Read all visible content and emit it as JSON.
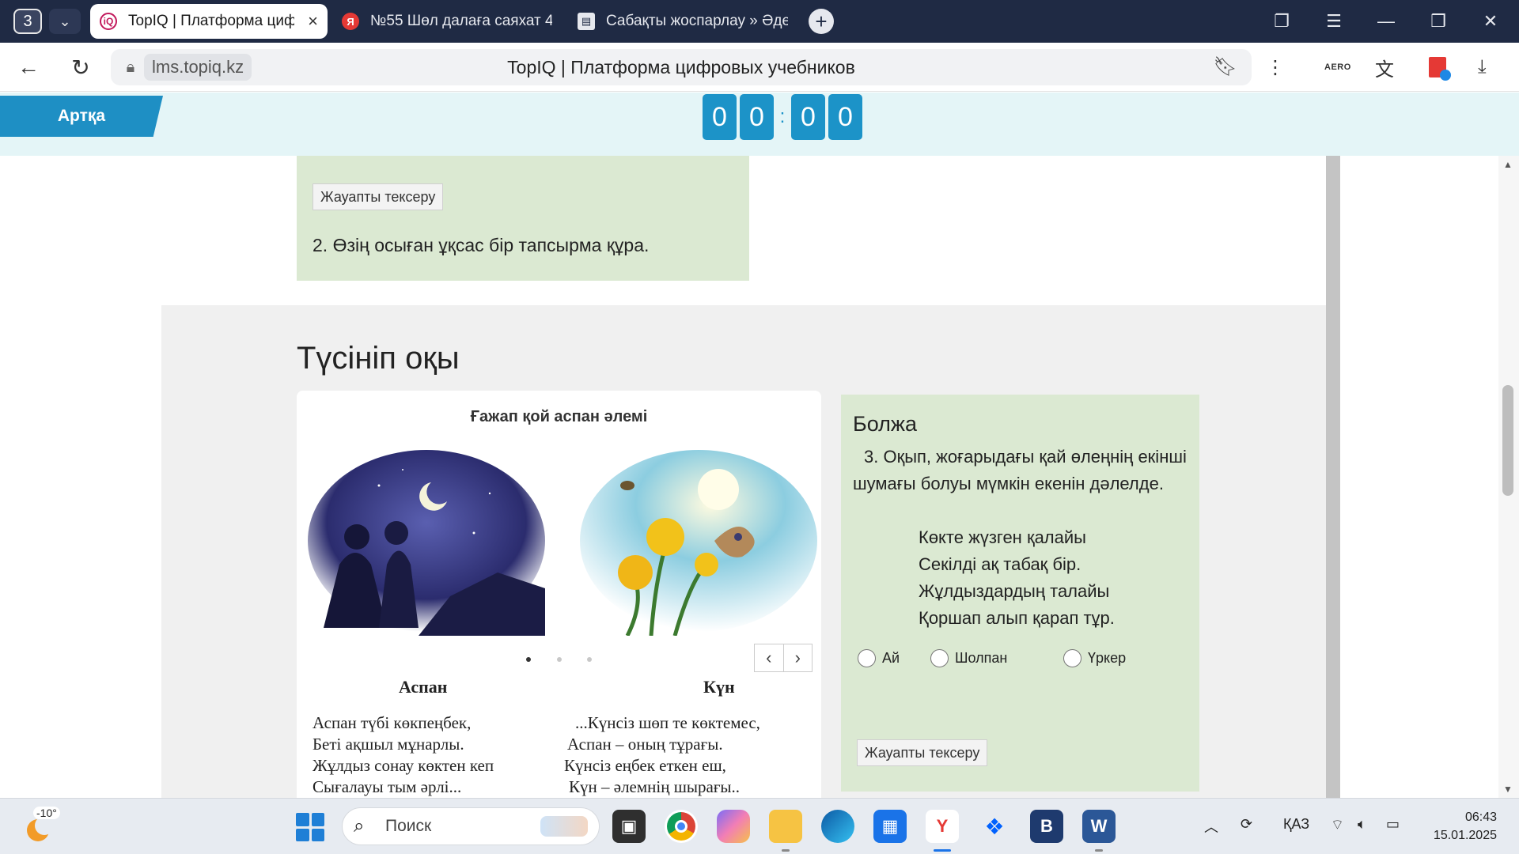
{
  "browser": {
    "tab_count": "3",
    "tabs": [
      {
        "title": "TopIQ | Платформа цифровых учебников",
        "visible": "TopIQ | Платформа циф"
      },
      {
        "title": "№55 Шөл далаға саяхат 4",
        "visible": "№55 Шөл далаға саяхат 4"
      },
      {
        "title": "Сабақты жоспарлау » Әде",
        "visible": "Сабақты жоспарлау » Әде"
      }
    ],
    "domain": "lms.topiq.kz",
    "page_title": "TopIQ | Платформа цифровых учебников",
    "aero_label": "AERO"
  },
  "app": {
    "back_label": "Артқа",
    "timer": [
      "0",
      "0",
      "0",
      "0"
    ],
    "timer_sep": ":"
  },
  "content": {
    "check_answer_1": "Жауапты тексеру",
    "task2": "2. Өзің осыған ұқсас бір тапсырма құра.",
    "section_title": "Түсініп оқы",
    "story": {
      "title": "Ғажап қой аспан әлемі",
      "poems": [
        {
          "title": "Аспан",
          "lines": [
            "Аспан түбі көкпеңбек,",
            "Беті ақшыл мұнарлы.",
            "Жұлдыз сонау көктен кеп",
            "Сығалауы тым әрлі..."
          ]
        },
        {
          "title": "Күн",
          "lines": [
            "...Күнсіз шөп те көктемес,",
            "Аспан – оның тұрағы.",
            "Күнсіз еңбек еткен еш,",
            "Күн – әлемнің шырағы.."
          ]
        }
      ]
    },
    "side": {
      "title": "Болжа",
      "question": "3. Оқып, жоғарыдағы қай өлеңнің екінші шумағы болуы мүмкін екенін дәлелде.",
      "poem_lines": [
        "Көкте жүзген қалайы",
        "Секілді ақ табақ бір.",
        "Жұлдыздардың талайы",
        "Қоршап алып қарап тұр."
      ],
      "options": [
        "Ай",
        "Шолпан",
        "Үркер"
      ],
      "check_answer": "Жауапты тексеру"
    }
  },
  "taskbar": {
    "weather_temp": "-10°",
    "search_placeholder": "Поиск",
    "language": "ҚАЗ",
    "time": "06:43",
    "date": "15.01.2025"
  }
}
